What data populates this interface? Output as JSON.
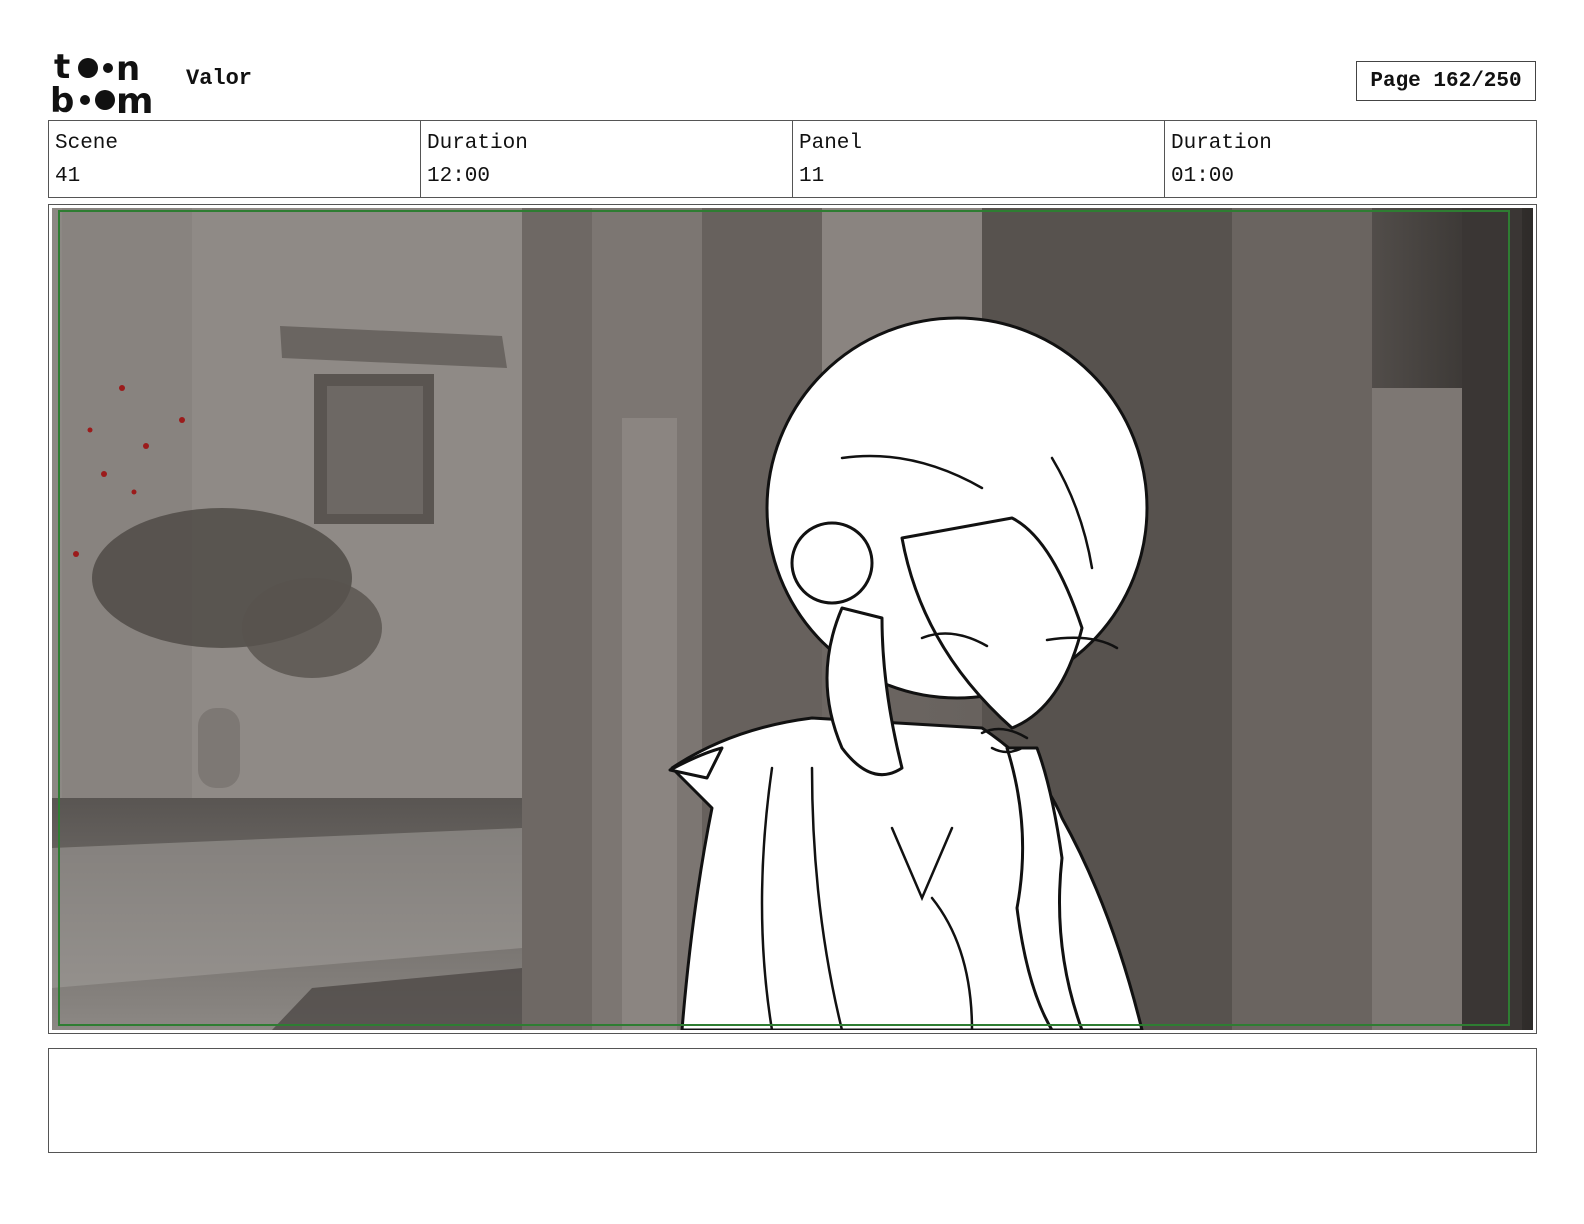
{
  "header": {
    "brand": "toon boom",
    "project_title": "Valor",
    "page_label": "Page 162/250"
  },
  "info": [
    {
      "label": "Scene",
      "value": "41"
    },
    {
      "label": "Duration",
      "value": "12:00"
    },
    {
      "label": "Panel",
      "value": "11"
    },
    {
      "label": "Duration",
      "value": "01:00"
    }
  ],
  "panel": {
    "safe_frame_color": "#2e7d32",
    "marker_color": "#9b1b1b"
  },
  "notes": {
    "text": ""
  }
}
